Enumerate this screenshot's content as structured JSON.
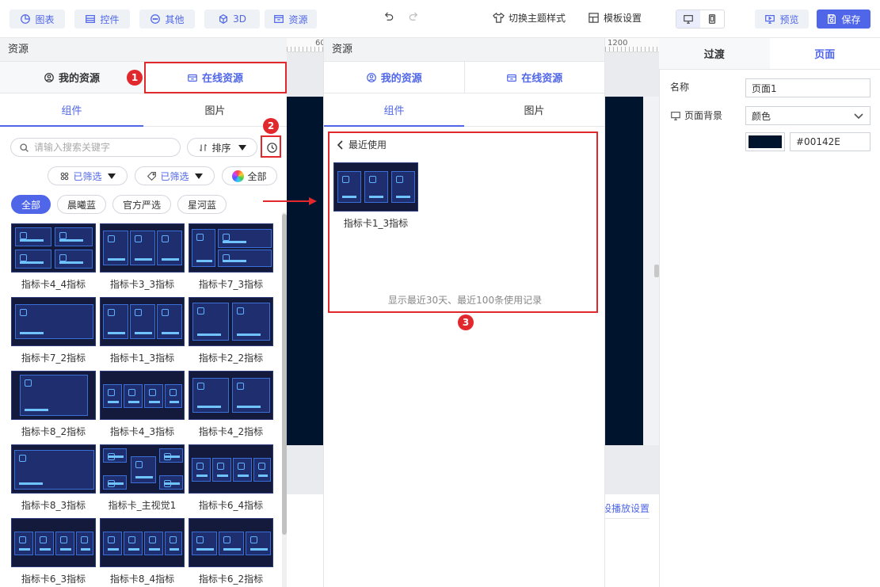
{
  "toolbar": {
    "chart": "图表",
    "widget": "控件",
    "other": "其他",
    "three_d": "3D",
    "resource": "资源",
    "theme": "切换主题样式",
    "template": "模板设置",
    "preview": "预览",
    "save": "保存"
  },
  "ruler": {
    "left_mark": "60",
    "right_mark": "1200"
  },
  "left_panel": {
    "title": "资源",
    "tab_mine": "我的资源",
    "tab_online": "在线资源",
    "sub_component": "组件",
    "sub_image": "图片",
    "search_placeholder": "请输入搜索关键字",
    "sort_label": "排序",
    "filter1": "已筛选",
    "filter2": "已筛选",
    "all_colors": "全部",
    "chips": [
      "全部",
      "晨曦蓝",
      "官方严选",
      "星河蓝"
    ],
    "cards": [
      {
        "label": "指标卡4_4指标"
      },
      {
        "label": "指标卡3_3指标"
      },
      {
        "label": "指标卡7_3指标"
      },
      {
        "label": "指标卡7_2指标"
      },
      {
        "label": "指标卡1_3指标"
      },
      {
        "label": "指标卡2_2指标"
      },
      {
        "label": "指标卡8_2指标"
      },
      {
        "label": "指标卡4_3指标"
      },
      {
        "label": "指标卡4_2指标"
      },
      {
        "label": "指标卡8_3指标"
      },
      {
        "label": "指标卡_主视觉1"
      },
      {
        "label": "指标卡6_4指标"
      },
      {
        "label": "指标卡6_3指标"
      },
      {
        "label": "指标卡8_4指标"
      },
      {
        "label": "指标卡6_2指标"
      }
    ]
  },
  "annotations": {
    "one": "1",
    "two": "2",
    "three": "3"
  },
  "middle_panel": {
    "title": "资源",
    "tab_mine": "我的资源",
    "tab_online": "在线资源",
    "sub_component": "组件",
    "sub_image": "图片",
    "back_label": "最近使用",
    "recent_card_label": "指标卡1_3指标",
    "note": "显示最近30天、最近100条使用记录"
  },
  "lower_link": "设播放设置",
  "right_panel": {
    "tab_transition": "过渡",
    "tab_page": "页面",
    "name_label": "名称",
    "name_value": "页面1",
    "bg_label": "页面背景",
    "bg_type": "颜色",
    "bg_color_hex": "#00142E"
  },
  "colors": {
    "accent": "#4f66e8",
    "highlight_red": "#e0282d",
    "canvas_bg": "#00142e"
  }
}
